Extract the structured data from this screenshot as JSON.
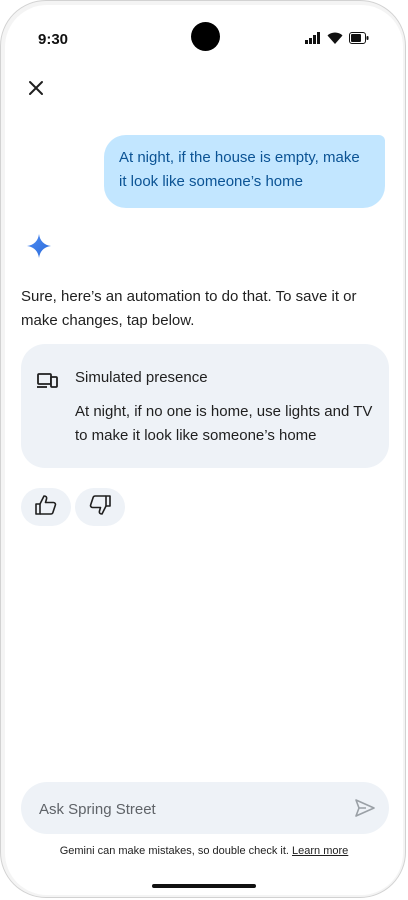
{
  "status": {
    "time": "9:30",
    "icons": [
      "signal-icon",
      "wifi-icon",
      "battery-icon"
    ]
  },
  "header": {
    "close_icon": "close-icon"
  },
  "conversation": {
    "user_message": "At night, if the house is empty, make it look like someone’s home",
    "assistant_icon": "sparkle-icon",
    "assistant_text": "Sure, here’s an automation to do that. To save it or make changes, tap below.",
    "automation_card": {
      "icon": "devices-icon",
      "title": "Simulated presence",
      "description": "At night, if no one is home, use lights and TV to make it look like someone’s home"
    },
    "feedback": {
      "thumbs_up_icon": "thumbs-up-icon",
      "thumbs_down_icon": "thumbs-down-icon"
    }
  },
  "composer": {
    "placeholder": "Ask Spring Street",
    "value": "",
    "send_icon": "send-icon"
  },
  "footer": {
    "disclaimer": "Gemini can make mistakes, so double check it.",
    "learn_more": "Learn more"
  },
  "colors": {
    "user_bubble_bg": "#c2e6ff",
    "user_bubble_text": "#0b5394",
    "card_bg": "#eef2f7",
    "sparkle": "#4285f4"
  }
}
